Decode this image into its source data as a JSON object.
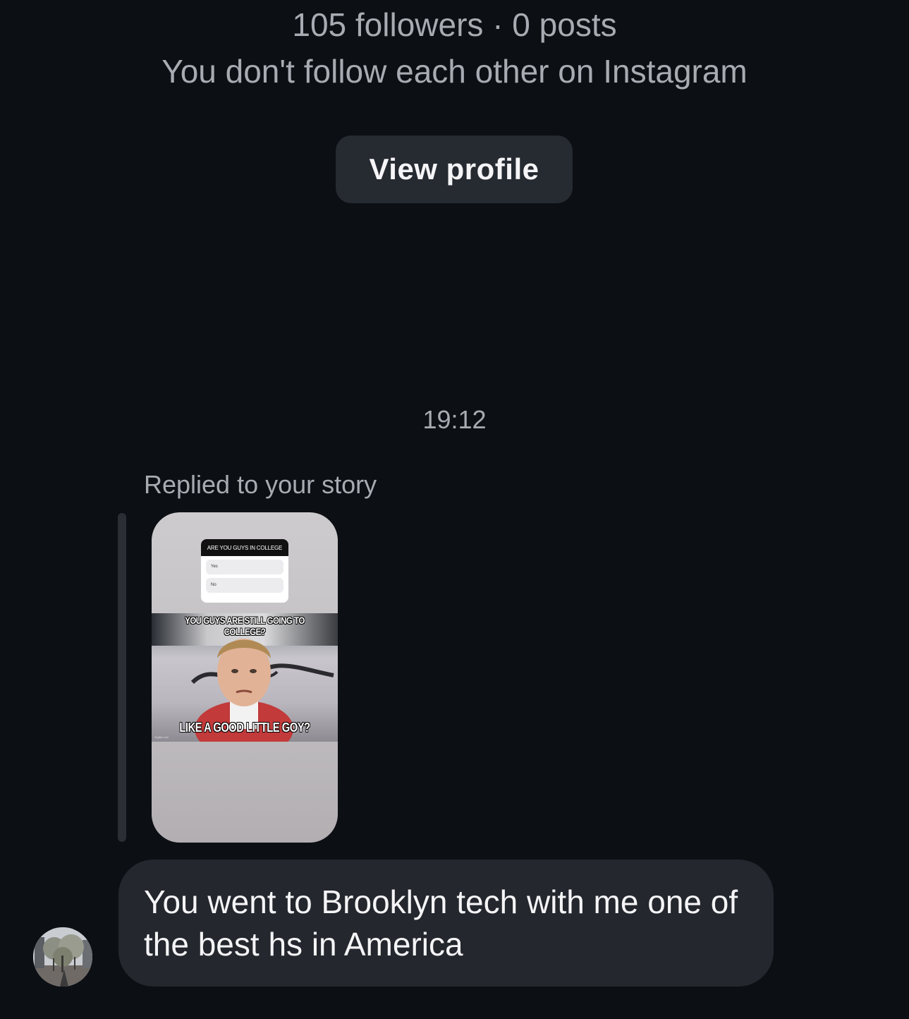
{
  "profile": {
    "followers_posts": "105 followers · 0 posts",
    "follow_status": "You don't follow each other on Instagram",
    "view_profile_label": "View profile"
  },
  "thread": {
    "timestamp": "19:12",
    "reply_context": "Replied to your story"
  },
  "story": {
    "poll_question": "ARE YOU GUYS IN COLLEGE",
    "poll_options": [
      "Yes",
      "No"
    ],
    "meme_top_text": "YOU GUYS ARE STILL GOING TO COLLEGE?",
    "meme_bottom_text": "LIKE A GOOD LITTLE GOY?",
    "watermark": "imgflip.com"
  },
  "message": {
    "text": "You went to Brooklyn tech with me one of the best hs in America"
  },
  "colors": {
    "background": "#0c0f14",
    "bubble": "#24272d",
    "button": "#262a31",
    "secondary_text": "#a8abb2",
    "primary_text": "#f5f5f7"
  },
  "icons": {
    "avatar": "user-avatar-photo"
  }
}
